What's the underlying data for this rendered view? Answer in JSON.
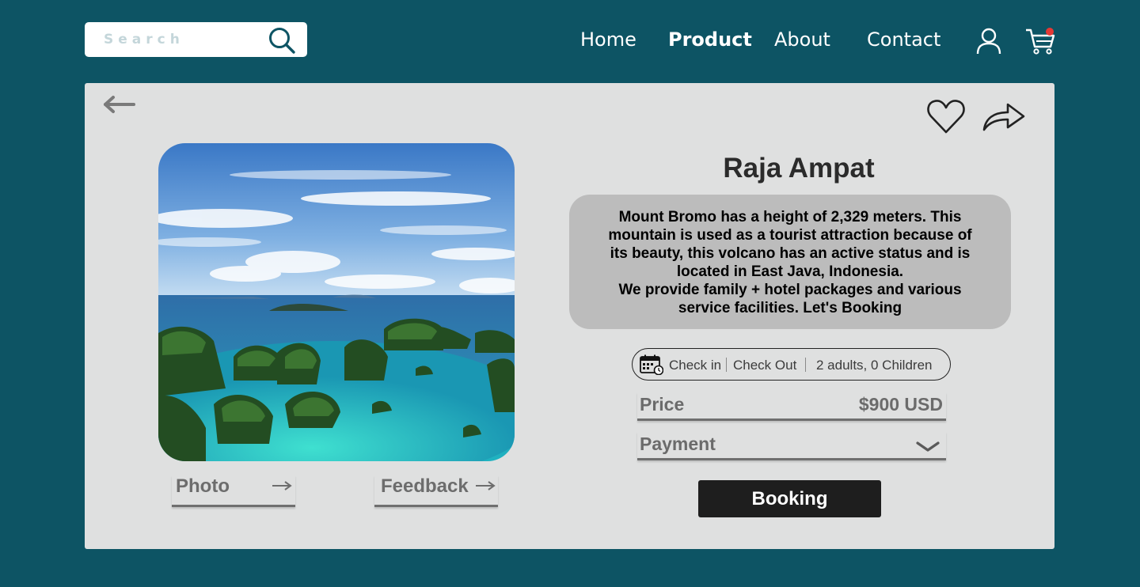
{
  "header": {
    "search": {
      "placeholder": "Search"
    },
    "nav": [
      {
        "label": "Home",
        "active": false
      },
      {
        "label": "Product",
        "active": true
      },
      {
        "label": "About",
        "active": false
      },
      {
        "label": "Contact",
        "active": false
      }
    ],
    "icons": {
      "search": "search-icon",
      "user": "user-icon",
      "cart": "cart-icon"
    },
    "cart_badge_color": "#e53935"
  },
  "product": {
    "title": "Raja Ampat",
    "description_lines": [
      "Mount Bromo has a height of 2,329 meters. This mountain is used as a tourist attraction because of its beauty, this volcano has an active status and is located in East Java, Indonesia.",
      "We provide family + hotel packages and various service facilities. Let's Booking"
    ],
    "tabs": {
      "photo": "Photo",
      "feedback": "Feedback"
    },
    "booking_bar": {
      "check_in": "Check in",
      "check_out": "Check Out",
      "guests": "2 adults, 0 Children"
    },
    "price": {
      "label": "Price",
      "value": "$900 USD"
    },
    "payment": {
      "label": "Payment"
    },
    "book_button": "Booking"
  },
  "colors": {
    "background": "#0d5464",
    "card": "#dfe0e0",
    "button": "#1e1e1e"
  }
}
